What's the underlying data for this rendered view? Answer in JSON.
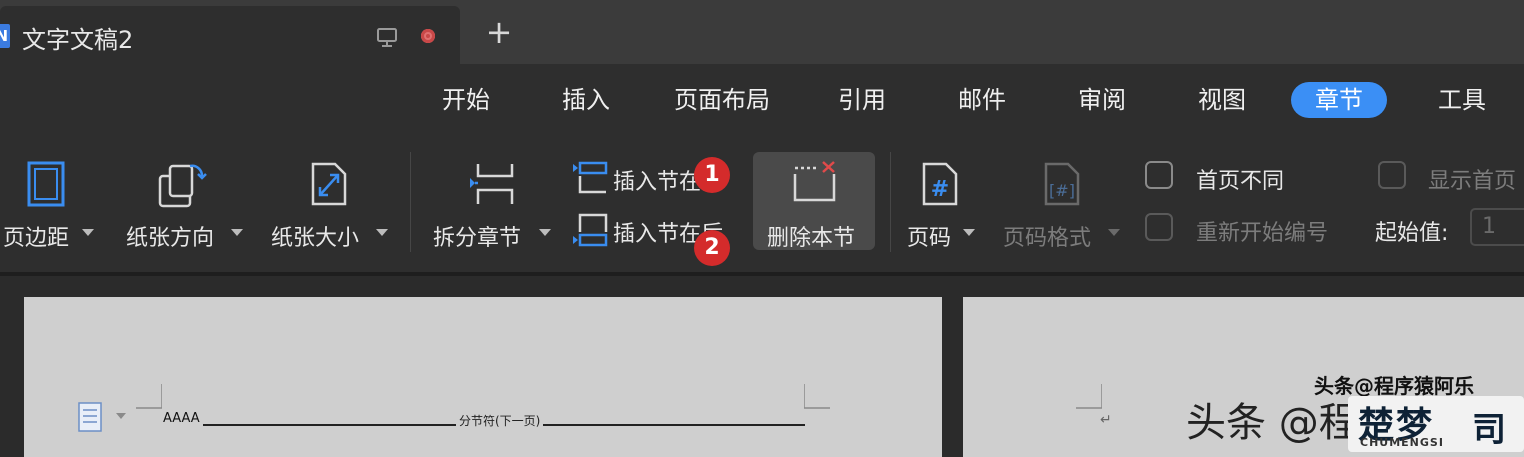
{
  "tab": {
    "app_icon": "N",
    "title": "文字文稿2",
    "new_tab": "+"
  },
  "menu": [
    "开始",
    "插入",
    "页面布局",
    "引用",
    "邮件",
    "审阅",
    "视图",
    "章节",
    "工具"
  ],
  "ribbon": {
    "margins": "页边距",
    "orientation": "纸张方向",
    "size": "纸张大小",
    "split_section": "拆分章节",
    "insert_section_before": "插入节在前",
    "insert_section_after": "插入节在后",
    "delete_section": "删除本节",
    "page_number": "页码",
    "page_number_format": "页码格式",
    "first_page_different": "首页不同",
    "restart_numbering": "重新开始编号",
    "show_first_page": "显示首页",
    "start_value_label": "起始值:",
    "start_value": "1"
  },
  "badges": [
    "1",
    "2"
  ],
  "document": {
    "text": "AAAA",
    "section_break": "分节符(下一页)",
    "paragraph_mark": "↵"
  },
  "watermark": {
    "line1": "头条@程序猿阿乐",
    "line2": "头条 @程",
    "logo": "楚梦",
    "logo_sub": "CHUMENGSI",
    "logo_mark": "司"
  },
  "colors": {
    "accent": "#3b8ff5",
    "badge": "#d42b2b",
    "icon_blue": "#3a8df0"
  }
}
